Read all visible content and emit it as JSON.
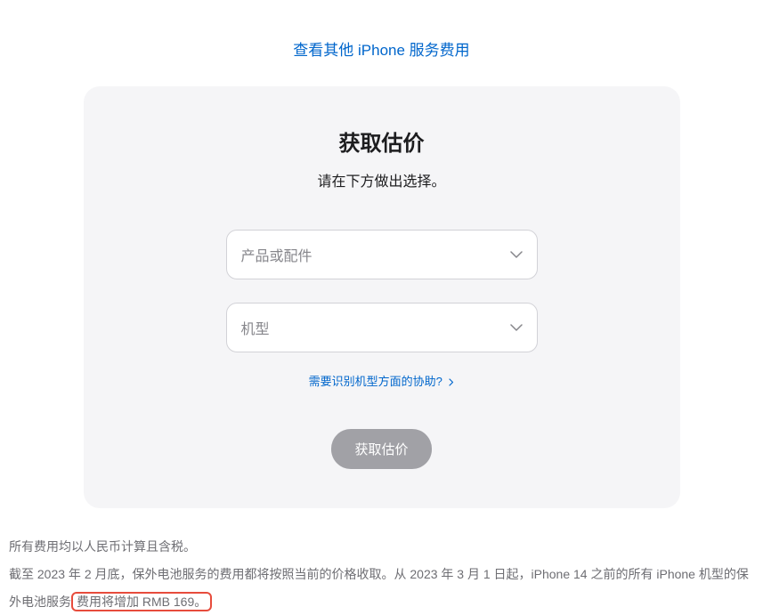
{
  "header": {
    "link_text": "查看其他 iPhone 服务费用"
  },
  "card": {
    "title": "获取估价",
    "subtitle": "请在下方做出选择。",
    "select_product_placeholder": "产品或配件",
    "select_model_placeholder": "机型",
    "help_link_text": "需要识别机型方面的协助?",
    "button_label": "获取估价"
  },
  "footer": {
    "line1": "所有费用均以人民币计算且含税。",
    "line2_part1": "截至 2023 年 2 月底，保外电池服务的费用都将按照当前的价格收取。从 2023 年 3 月 1 日起，iPhone 14 之前的所有 iPhone 机型的保外电池服务",
    "line2_highlighted": "费用将增加 RMB 169。"
  }
}
